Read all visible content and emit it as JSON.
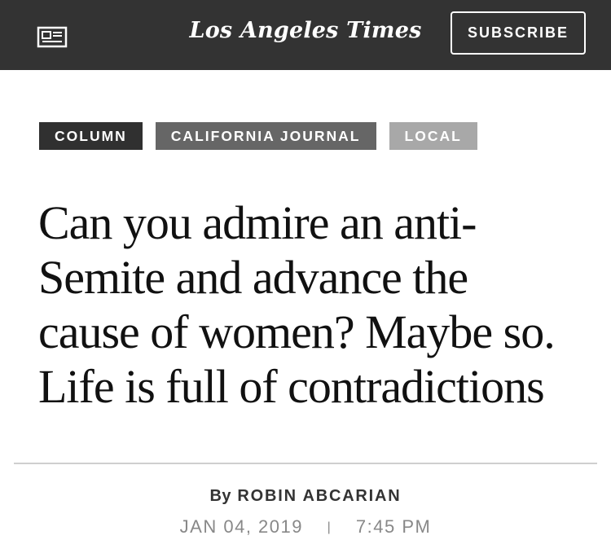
{
  "header": {
    "logo_text": "Los Angeles Times",
    "subscribe_label": "SUBSCRIBE",
    "menu_icon": "newspaper-icon",
    "background": "#333333"
  },
  "tags": [
    {
      "label": "COLUMN",
      "color": "#303030"
    },
    {
      "label": "CALIFORNIA JOURNAL",
      "color": "#666666"
    },
    {
      "label": "LOCAL",
      "color": "#a8a8a8"
    }
  ],
  "article": {
    "headline_lines": [
      "Can you admire an anti-",
      "Semite and advance the",
      "cause of women? Maybe so.",
      "Life is full of contradictions"
    ],
    "byline_prefix": "By",
    "author": "ROBIN ABCARIAN",
    "date": "JAN 04, 2019",
    "separator": "|",
    "time": "7:45 PM"
  }
}
